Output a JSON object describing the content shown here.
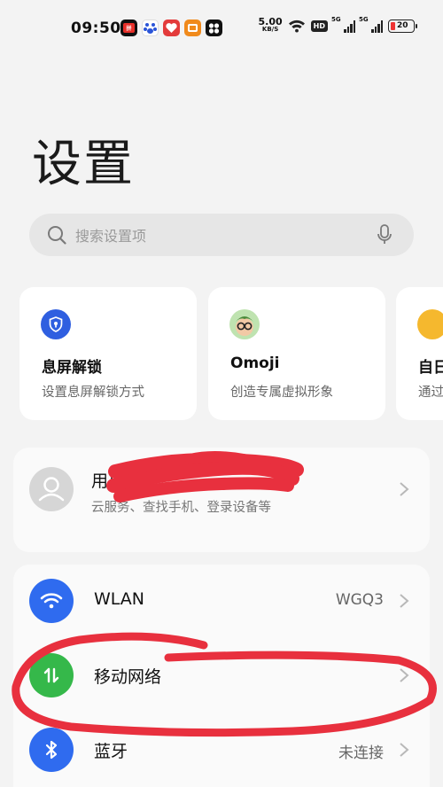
{
  "status_bar": {
    "time": "09:50",
    "net_speed": "5.00",
    "net_speed_unit": "KB/S",
    "hd_label": "HD",
    "sim1_label": "5G",
    "sim2_label": "5G",
    "battery": "20",
    "app_icons": [
      "app-icon-1",
      "app-icon-2",
      "app-icon-3",
      "app-icon-4",
      "app-icon-5"
    ]
  },
  "page": {
    "title": "设置"
  },
  "search": {
    "placeholder": "搜索设置项",
    "icon": "search-icon",
    "mic_icon": "microphone-icon"
  },
  "quick_cards": [
    {
      "title": "息屏解锁",
      "subtitle": "设置息屏解锁方式",
      "icon": "shield-lock-icon",
      "color": "#2f5fe0"
    },
    {
      "title": "Omoji",
      "subtitle": "创造专属虚拟形象",
      "icon": "omoji-avatar-icon"
    },
    {
      "title": "自日",
      "subtitle": "通过",
      "icon": "partial-card-icon",
      "color": "#f5b82e"
    }
  ],
  "account": {
    "name": "用户",
    "subtitle": "云服务、查找手机、登录设备等"
  },
  "settings_rows": [
    {
      "label": "WLAN",
      "value": "WGQ3",
      "icon": "wifi-icon",
      "color": "#2f6bef"
    },
    {
      "label": "移动网络",
      "value": "",
      "icon": "mobile-data-icon",
      "color": "#35b84a"
    },
    {
      "label": "蓝牙",
      "value": "未连接",
      "icon": "bluetooth-icon",
      "color": "#2f6bef"
    }
  ],
  "colors": {
    "background": "#f3f3f3",
    "redaction_ink": "#e8303e"
  }
}
